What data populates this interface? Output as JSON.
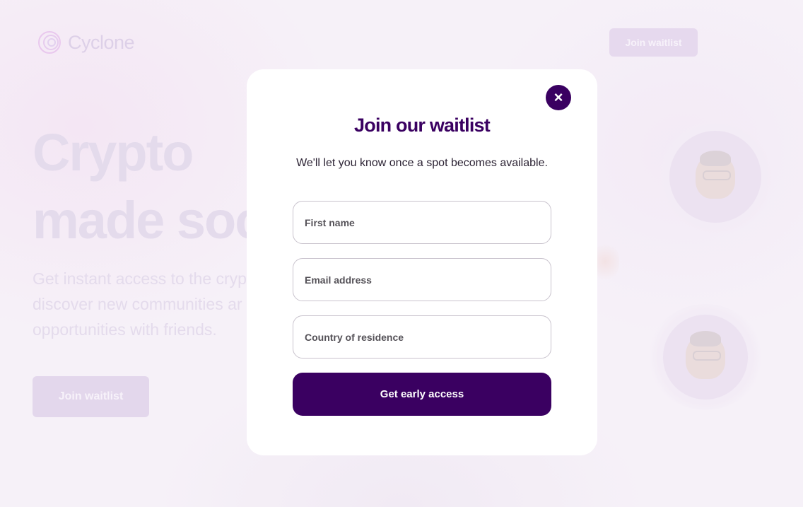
{
  "background": {
    "brand": {
      "name": "Cyclone"
    },
    "nav": {
      "join_label": "Join waitlist"
    },
    "hero": {
      "title_line1": "Crypto",
      "title_line2": "made soc",
      "subtitle_line1": "Get instant access to the cryp",
      "subtitle_line2": "discover new communities ar",
      "subtitle_line3": "opportunities with friends.",
      "join_label": "Join waitlist"
    }
  },
  "modal": {
    "close_icon": "×",
    "title": "Join our waitlist",
    "subtitle": "We'll let you know once a spot becomes available.",
    "fields": {
      "first_name": {
        "placeholder": "First name",
        "value": ""
      },
      "email": {
        "placeholder": "Email address",
        "value": ""
      },
      "country": {
        "placeholder": "Country of residence",
        "value": ""
      }
    },
    "submit_label": "Get early access"
  },
  "colors": {
    "primary": "#3a0061",
    "backdrop": "#f6f1f8",
    "muted_text": "#e4dbec"
  }
}
